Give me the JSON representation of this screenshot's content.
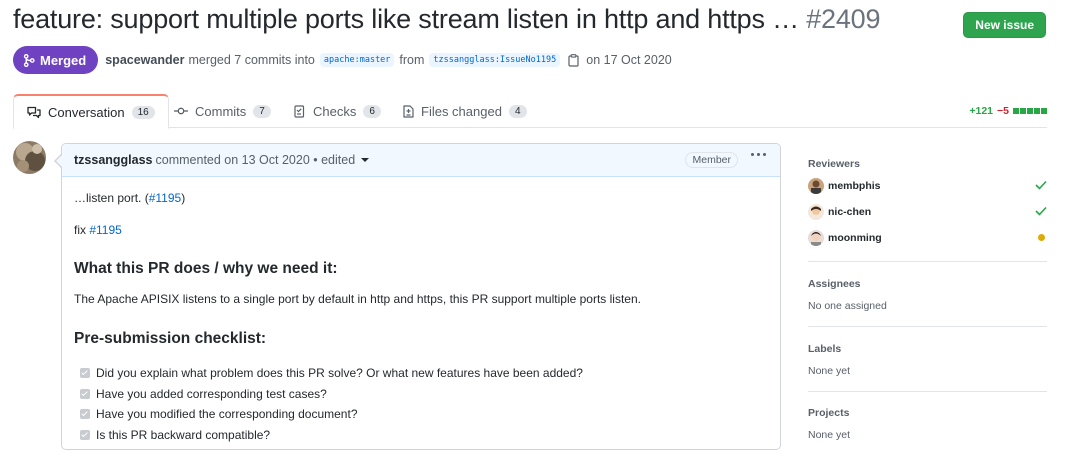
{
  "header": {
    "title": "feature: support multiple ports like stream listen in http and https …",
    "number": "#2409",
    "new_issue_label": "New issue"
  },
  "meta": {
    "state": "Merged",
    "author": "spacewander",
    "merged_text": "merged 7 commits into",
    "base_branch": "apache:master",
    "from_text": "from",
    "head_branch": "tzssangglass:IssueNo1195",
    "date_text": "on 17 Oct 2020"
  },
  "tabs": [
    {
      "label": "Conversation",
      "count": "16",
      "icon": "comment-discussion-icon"
    },
    {
      "label": "Commits",
      "count": "7",
      "icon": "commit-icon"
    },
    {
      "label": "Checks",
      "count": "6",
      "icon": "checklist-icon"
    },
    {
      "label": "Files changed",
      "count": "4",
      "icon": "file-diff-icon"
    }
  ],
  "diffstat": {
    "additions": "+121",
    "deletions": "−5"
  },
  "comment": {
    "author": "tzssangglass",
    "meta": "commented on 13 Oct 2020 • edited",
    "role": "Member",
    "line1_prefix": "…listen port. (",
    "line1_link": "#1195",
    "line1_suffix": ")",
    "line2_prefix": "fix ",
    "line2_link": "#1195",
    "heading1": "What this PR does / why we need it:",
    "paragraph": "The Apache APISIX listens to a single port by default in http and https, this PR support multiple ports listen.",
    "heading2": "Pre-submission checklist:",
    "checklist": [
      "Did you explain what problem does this PR solve? Or what new features have been added?",
      "Have you added corresponding test cases?",
      "Have you modified the corresponding document?",
      "Is this PR backward compatible?"
    ]
  },
  "sidebar": {
    "reviewers_title": "Reviewers",
    "reviewers": [
      {
        "name": "membphis",
        "status": "approved"
      },
      {
        "name": "nic-chen",
        "status": "approved"
      },
      {
        "name": "moonming",
        "status": "pending"
      }
    ],
    "assignees_title": "Assignees",
    "assignees_value": "No one assigned",
    "labels_title": "Labels",
    "labels_value": "None yet",
    "projects_title": "Projects",
    "projects_value": "None yet"
  },
  "colors": {
    "merged": "#6f42c1",
    "new_issue": "#2ea44f",
    "link": "#0366d6",
    "approved": "#28a745",
    "pending": "#dbab09",
    "deletion": "#cb2431"
  }
}
